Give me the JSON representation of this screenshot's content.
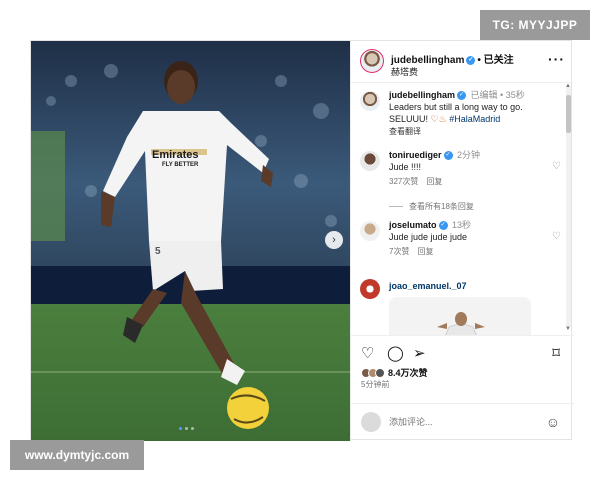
{
  "watermarks": {
    "top": "TG: MYYJJPP",
    "bottom": "www.dymtyjc.com"
  },
  "post": {
    "author": "judebellingham",
    "follow_state": "已关注",
    "location": "赫塔费",
    "photo": {
      "sponsor": "Emirates",
      "sponsor_sub": "FLY BETTER",
      "number": "5"
    },
    "carousel": {
      "count": 3,
      "active": 1
    }
  },
  "caption": {
    "user": "judebellingham",
    "edited": "已编辑",
    "time": "35秒",
    "text_line1": "Leaders but still a long way to go.",
    "text_line2": "SELUUU!",
    "hashtag": "#HalaMadrid",
    "translate": "查看翻译"
  },
  "comments": [
    {
      "user": "toniruediger",
      "time": "2分钟",
      "text": "Jude !!!!",
      "likes": "327次赞",
      "reply": "回复",
      "view_replies": "查看所有18条回复"
    },
    {
      "user": "joselumato",
      "time": "13秒",
      "text": "Jude jude jude jude",
      "likes": "7次赞",
      "reply": "回复"
    },
    {
      "user": "joao_emanuel._07"
    }
  ],
  "actions": {
    "likes": "8.4万次赞",
    "ago": "5分钟前"
  },
  "add_comment": {
    "placeholder": "添加评论..."
  },
  "colors": {
    "link": "#00376b",
    "verified": "#3897f0",
    "story_ring": "#e1306c"
  },
  "icons": [
    "heart-icon",
    "comment-icon",
    "share-icon",
    "bookmark-icon",
    "emoji-icon",
    "more-icon",
    "next-icon"
  ]
}
